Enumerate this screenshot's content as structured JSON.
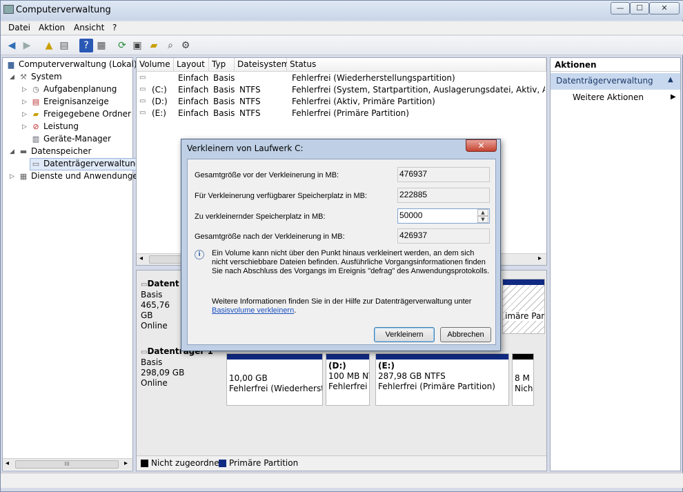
{
  "window": {
    "title": "Computerverwaltung",
    "min": "—",
    "max": "☐",
    "close": "✕"
  },
  "menu": [
    "Datei",
    "Aktion",
    "Ansicht",
    "?"
  ],
  "tree": [
    {
      "label": "Computerverwaltung (Lokal)",
      "icon": "computer-icon"
    },
    {
      "label": "System",
      "icon": "tools-icon"
    },
    {
      "label": "Aufgabenplanung",
      "icon": "clock-icon"
    },
    {
      "label": "Ereignisanzeige",
      "icon": "event-viewer-icon"
    },
    {
      "label": "Freigegebene Ordner",
      "icon": "shared-folder-icon"
    },
    {
      "label": "Leistung",
      "icon": "performance-icon"
    },
    {
      "label": "Geräte-Manager",
      "icon": "device-manager-icon"
    },
    {
      "label": "Datenspeicher",
      "icon": "storage-icon"
    },
    {
      "label": "Datenträgerverwaltung",
      "icon": "disk-management-icon"
    },
    {
      "label": "Dienste und Anwendungen",
      "icon": "services-icon"
    }
  ],
  "table": {
    "headers": [
      "Volume",
      "Layout",
      "Typ",
      "Dateisystem",
      "Status"
    ],
    "rows": [
      {
        "volume": "",
        "layout": "Einfach",
        "typ": "Basis",
        "fs": "",
        "status": "Fehlerfrei (Wiederherstellungspartition)"
      },
      {
        "volume": "(C:)",
        "layout": "Einfach",
        "typ": "Basis",
        "fs": "NTFS",
        "status": "Fehlerfrei (System, Startpartition, Auslagerungsdatei, Aktiv, Absturzabb"
      },
      {
        "volume": "(D:)",
        "layout": "Einfach",
        "typ": "Basis",
        "fs": "NTFS",
        "status": "Fehlerfrei (Aktiv, Primäre Partition)"
      },
      {
        "volume": "(E:)",
        "layout": "Einfach",
        "typ": "Basis",
        "fs": "NTFS",
        "status": "Fehlerfrei (Primäre Partition)"
      }
    ]
  },
  "disks": [
    {
      "name": "Datent",
      "type": "Basis",
      "size": "465,76 GB",
      "state": "Online",
      "tail": "imäre Par"
    },
    {
      "name": "Datenträger 1",
      "type": "Basis",
      "size": "298,09 GB",
      "state": "Online"
    }
  ],
  "partitions": [
    {
      "title": "",
      "size": "10,00 GB",
      "status": "Fehlerfrei (Wiederherstel"
    },
    {
      "title": "(D:)",
      "size": "100 MB NT",
      "status": "Fehlerfrei ("
    },
    {
      "title": "(E:)",
      "size": "287,98 GB NTFS",
      "status": "Fehlerfrei (Primäre Partition)"
    },
    {
      "title": "",
      "size": "8 M",
      "status": "Nich"
    }
  ],
  "legend": {
    "unallocated": "Nicht zugeordnet",
    "primary": "Primäre Partition",
    "unallocated_color": "#000000",
    "primary_color": "#102a82"
  },
  "actions": {
    "header": "Aktionen",
    "section": "Datenträgerverwaltung",
    "more": "Weitere Aktionen"
  },
  "dialog": {
    "title": "Verkleinern von Laufwerk C:",
    "close": "✕",
    "total_before_label": "Gesamtgröße vor der Verkleinerung in MB:",
    "total_before": "476937",
    "available_label": "Für Verkleinerung verfügbarer Speicherplatz in MB:",
    "available": "222885",
    "shrink_label": "Zu verkleinernder Speicherplatz in MB:",
    "shrink_value": "50000",
    "total_after_label": "Gesamtgröße nach der Verkleinerung in MB:",
    "total_after": "426937",
    "info_text": "Ein Volume kann nicht über den Punkt hinaus verkleinert werden, an dem sich nicht verschiebbare Dateien befinden. Ausführliche Vorgangsinformationen finden Sie nach Abschluss des Vorgangs im Ereignis \"defrag\" des Anwendungsprotokolls.",
    "help_text": "Weitere Informationen finden Sie in der Hilfe zur Datenträgerverwaltung unter",
    "help_link": "Basisvolume verkleinern",
    "help_suffix": ".",
    "ok_button": "Verkleinern",
    "cancel_button": "Abbrechen"
  },
  "scroll": {
    "grip": "III",
    "left": "◂",
    "right": "▸"
  }
}
